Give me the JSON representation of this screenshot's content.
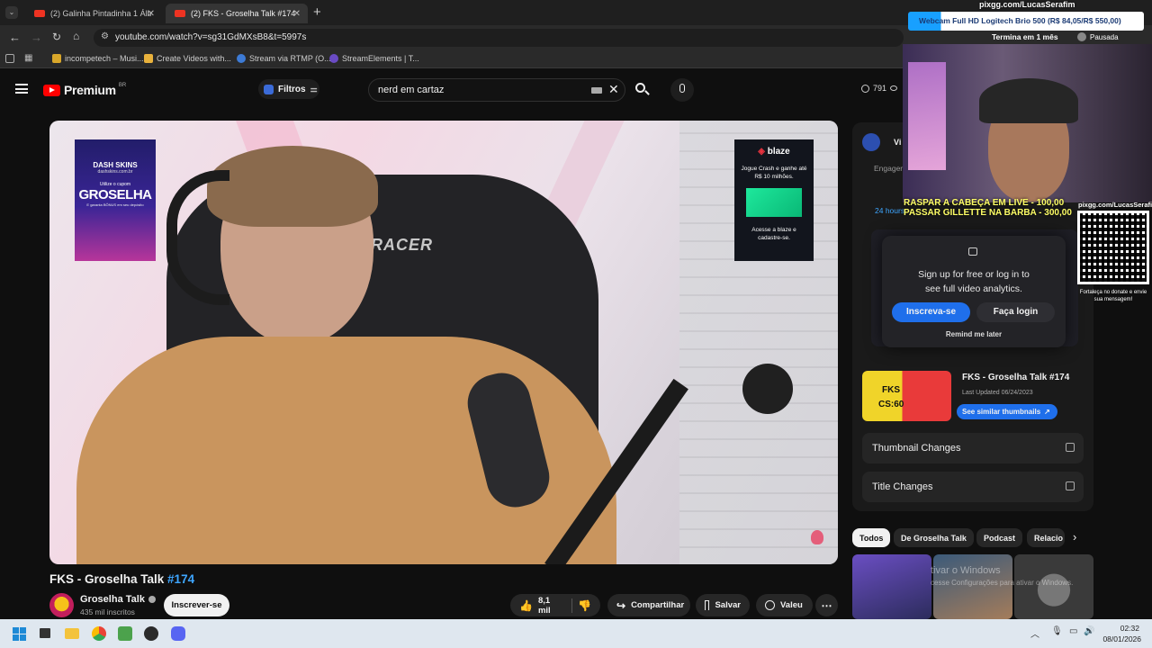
{
  "browser": {
    "tabs": [
      {
        "title": "(2) Galinha Pintadinha 1 Álbum",
        "active": false
      },
      {
        "title": "(2) FKS - Groselha Talk #174 - Y",
        "active": true
      }
    ],
    "new_tab": "+",
    "url": "youtube.com/watch?v=sg31GdMXsB8&t=5997s",
    "bookmarks": [
      "incompetech – Musi...",
      "Create Videos with...",
      "Stream via RTMP (O...",
      "StreamElements | T..."
    ]
  },
  "youtube": {
    "logo_text": "Premium",
    "logo_region": "BR",
    "filters_label": "Filtros",
    "search_value": "nerd em cartaz",
    "views_badge": "791"
  },
  "video": {
    "title_main": "FKS - Groselha Talk ",
    "title_tag": "#174",
    "channel_name": "Groselha Talk",
    "subscribers": "435 mil inscritos",
    "subscribe_label": "Inscrever-se",
    "likes": "8,1 mil",
    "share_label": "Compartilhar",
    "save_label": "Salvar",
    "thanks_label": "Valeu",
    "overlay_left": {
      "brand": "DASH SKINS",
      "site": "dashskins.com.br",
      "promo": "Utilize o cupom",
      "code": "GROSELHA",
      "note": "E garanta BÔNUS em seu depósito"
    },
    "overlay_right": {
      "brand": "blaze",
      "text1": "Jogue Crash e ganhe até R$ 10 milhões.",
      "text2": "Acesse a blaze e cadastre-se."
    },
    "chair_brand": "DXRACER"
  },
  "analytics": {
    "tab_label": "Vi",
    "engagement_label": "Engager",
    "hours_label": "24 hours",
    "signup_text": "Sign up for free or log in to see full video analytics.",
    "signup_btn": "Inscreva-se",
    "login_btn": "Faça login",
    "remind": "Remind me later",
    "thumb_title": "FKS - Groselha Talk #174",
    "thumb_updated": "Last Updated 06/24/2023",
    "similar_btn": "See similar thumbnails",
    "thumb_text": "FKS",
    "thumb_score": "CS:60",
    "thumbnail_changes": "Thumbnail Changes",
    "title_changes": "Title Changes"
  },
  "chips": [
    "Todos",
    "De Groselha Talk",
    "Podcast",
    "Relacio"
  ],
  "stream_overlay": {
    "pix_top": "pixgg.com/LucasSerafim",
    "webcam_ad": "Webcam Full HD Logitech Brio 500 (R$ 84,05/R$ 550,00)",
    "timer": "Termina em 1 mês",
    "paused": "Pausada",
    "goal1": "RASPAR A CABEÇA EM LIVE - 100,00",
    "goal2": "PASSAR GILLETTE NA BARBA - 300,00",
    "pix_side": "pixgg.com/LucasSerafim",
    "qr_caption": "Fortaleça no donate e envie sua mensagem!"
  },
  "watermark": {
    "line1": "tivar o Windows",
    "line2": "cesse Configurações para ativar o Windows."
  },
  "taskbar": {
    "time": "02:32",
    "date": "08/01/2026"
  },
  "colors": {
    "accent": "#3ea6ff",
    "youtube_red": "#ff0000",
    "signup_blue": "#1f6feb"
  }
}
